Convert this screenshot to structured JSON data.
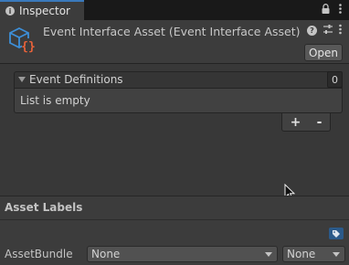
{
  "tab": {
    "label": "Inspector",
    "info_icon": "info-icon",
    "lock_icon": "lock-icon",
    "menu_icon": "kebab-menu-icon"
  },
  "header": {
    "title": "Event Interface Asset (Event Interface Asset)",
    "open_label": "Open",
    "icons": [
      "help-icon",
      "presets-icon",
      "kebab-menu-icon"
    ]
  },
  "event_definitions": {
    "label": "Event Definitions",
    "count": "0",
    "empty_text": "List is empty",
    "add_label": "+",
    "remove_label": "-"
  },
  "asset_labels": {
    "title": "Asset Labels",
    "tag_icon": "tag-icon",
    "asset_bundle_label": "AssetBundle",
    "bundle_value": "None",
    "variant_value": "None"
  },
  "colors": {
    "accent": "#3a79bb",
    "icon_blue": "#3d8fd8",
    "icon_orange": "#e8623a",
    "background": "#383838"
  }
}
